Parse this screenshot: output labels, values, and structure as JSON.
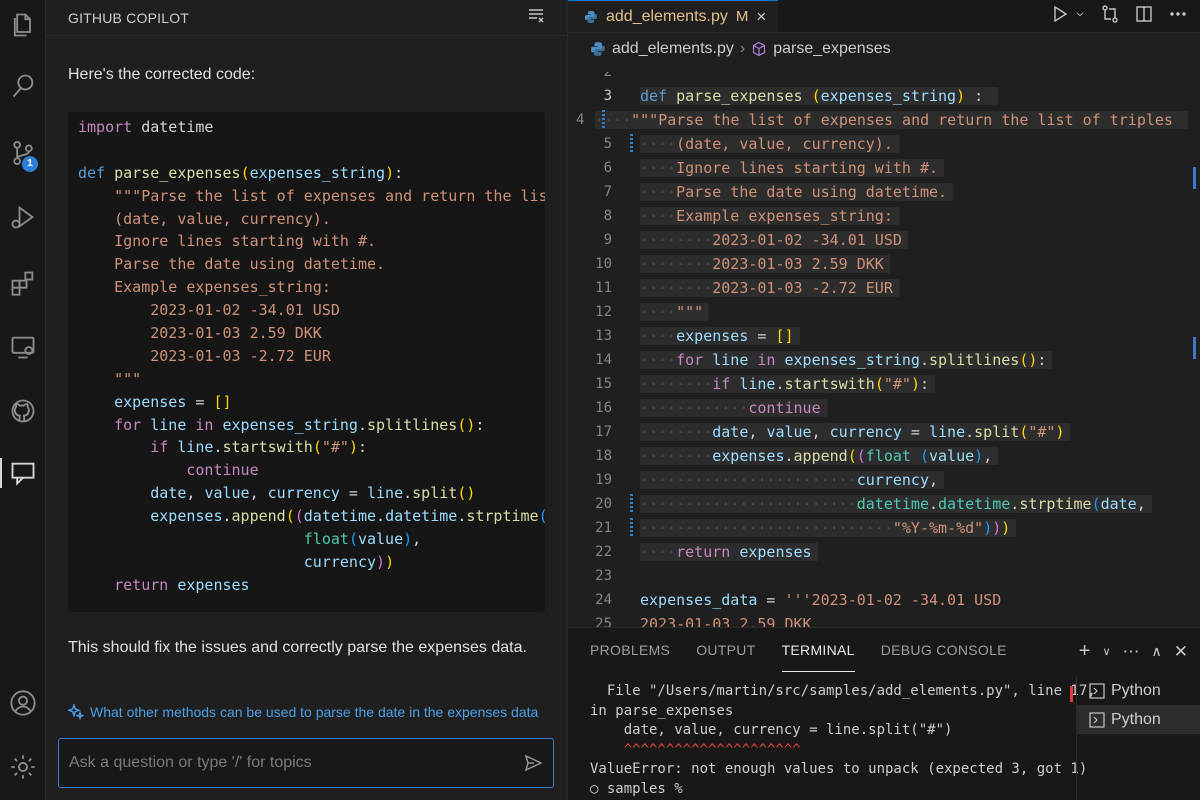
{
  "activity_bar": {
    "items": [
      {
        "name": "explorer",
        "icon": "files-icon"
      },
      {
        "name": "search",
        "icon": "search-icon"
      },
      {
        "name": "source-control",
        "icon": "source-control-icon",
        "badge": "1"
      },
      {
        "name": "run-debug",
        "icon": "run-debug-icon"
      },
      {
        "name": "extensions",
        "icon": "extensions-icon"
      },
      {
        "name": "remote-explorer",
        "icon": "remote-explorer-icon"
      },
      {
        "name": "github",
        "icon": "github-icon"
      },
      {
        "name": "chat",
        "icon": "chat-icon",
        "active": true
      },
      {
        "name": "accounts",
        "icon": "account-icon"
      },
      {
        "name": "manage",
        "icon": "gear-icon"
      }
    ]
  },
  "chat": {
    "title": "GITHUB COPILOT",
    "intro": "Here's the corrected code:",
    "code_lines": [
      "import datetime",
      "",
      "def parse_expenses(expenses_string):",
      "    \"\"\"Parse the list of expenses and return the list of tr",
      "    (date, value, currency).",
      "    Ignore lines starting with #.",
      "    Parse the date using datetime.",
      "    Example expenses_string:",
      "        2023-01-02 -34.01 USD",
      "        2023-01-03 2.59 DKK",
      "        2023-01-03 -2.72 EUR",
      "    \"\"\"",
      "    expenses = []",
      "    for line in expenses_string.splitlines():",
      "        if line.startswith(\"#\"):",
      "            continue",
      "        date, value, currency = line.split()",
      "        expenses.append((datetime.datetime.strptime(date, \"",
      "                         float(value),",
      "                         currency))",
      "    return expenses"
    ],
    "outro": "This should fix the issues and correctly parse the expenses data.",
    "suggestion": "What other methods can be used to parse the date in the expenses data",
    "input_placeholder": "Ask a question or type '/' for topics"
  },
  "editor": {
    "tab": {
      "filename": "add_elements.py",
      "modified": "M",
      "close": "×"
    },
    "breadcrumb": {
      "file": "add_elements.py",
      "symbol": "parse_expenses"
    },
    "partial_top_line": "2",
    "lines": [
      {
        "n": "3",
        "text": "def parse_expenses (expenses_string) :"
      },
      {
        "n": "4",
        "text": "    \"\"\"Parse the list of expenses and return the list of triples"
      },
      {
        "n": "5",
        "text": "    (date, value, currency)."
      },
      {
        "n": "6",
        "text": "    Ignore lines starting with #."
      },
      {
        "n": "7",
        "text": "    Parse the date using datetime."
      },
      {
        "n": "8",
        "text": "    Example expenses_string:"
      },
      {
        "n": "9",
        "text": "        2023-01-02 -34.01 USD"
      },
      {
        "n": "10",
        "text": "        2023-01-03 2.59 DKK"
      },
      {
        "n": "11",
        "text": "        2023-01-03 -2.72 EUR"
      },
      {
        "n": "12",
        "text": "    \"\"\""
      },
      {
        "n": "13",
        "text": "    expenses = []"
      },
      {
        "n": "14",
        "text": "    for line in expenses_string.splitlines():"
      },
      {
        "n": "15",
        "text": "        if line.startswith(\"#\"):"
      },
      {
        "n": "16",
        "text": "            continue"
      },
      {
        "n": "17",
        "text": "        date, value, currency = line.split(\"#\")"
      },
      {
        "n": "18",
        "text": "        expenses.append((float (value),"
      },
      {
        "n": "19",
        "text": "                        currency,"
      },
      {
        "n": "20",
        "text": "                        datetime.datetime.strptime(date,"
      },
      {
        "n": "21",
        "text": "                            \"%Y-%m-%d\")))"
      },
      {
        "n": "22",
        "text": "    return expenses"
      },
      {
        "n": "23",
        "text": ""
      },
      {
        "n": "24",
        "text": "expenses_data = '''2023-01-02 -34.01 USD"
      },
      {
        "n": "25",
        "text": "2023-01-03 2.59 DKK"
      }
    ]
  },
  "panel": {
    "tabs": [
      "PROBLEMS",
      "OUTPUT",
      "TERMINAL",
      "DEBUG CONSOLE"
    ],
    "active_tab": "TERMINAL",
    "terminal_lines": [
      "  File \"/Users/martin/src/samples/add_elements.py\", line 17,",
      "in parse_expenses",
      "    date, value, currency = line.split(\"#\")",
      "    ^^^^^^^^^^^^^^^^^^^^^",
      "ValueError: not enough values to unpack (expected 3, got 1)",
      "○ samples %"
    ],
    "terminals": [
      "Python",
      "Python"
    ]
  }
}
